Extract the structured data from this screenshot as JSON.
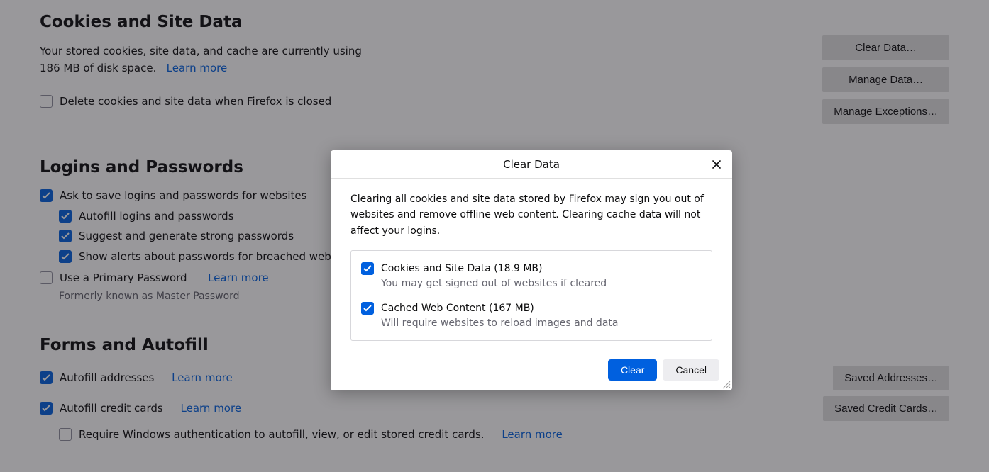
{
  "sections": {
    "cookies": {
      "title": "Cookies and Site Data",
      "desc1": "Your stored cookies, site data, and cache are currently using 186 MB of disk space.",
      "learn_more": "Learn more",
      "delete_on_close": "Delete cookies and site data when Firefox is closed",
      "clear_data_btn": "Clear Data…",
      "manage_data_btn": "Manage Data…",
      "manage_exceptions_btn": "Manage Exceptions…"
    },
    "logins": {
      "title": "Logins and Passwords",
      "ask_save": "Ask to save logins and passwords for websites",
      "autofill": "Autofill logins and passwords",
      "suggest": "Suggest and generate strong passwords",
      "alerts": "Show alerts about passwords for breached websites",
      "primary": "Use a Primary Password",
      "learn_more": "Learn more",
      "formerly": "Formerly known as Master Password"
    },
    "forms": {
      "title": "Forms and Autofill",
      "addresses": "Autofill addresses",
      "learn_more1": "Learn more",
      "saved_addresses_btn": "Saved Addresses…",
      "ccards": "Autofill credit cards",
      "learn_more2": "Learn more",
      "saved_cards_btn": "Saved Credit Cards…",
      "winauth": "Require Windows authentication to autofill, view, or edit stored credit cards.",
      "learn_more3": "Learn more"
    }
  },
  "dialog": {
    "title": "Clear Data",
    "desc": "Clearing all cookies and site data stored by Firefox may sign you out of websites and remove offline web content. Clearing cache data will not affect your logins.",
    "opt1_label": "Cookies and Site Data (18.9 MB)",
    "opt1_sub": "You may get signed out of websites if cleared",
    "opt2_label": "Cached Web Content (167 MB)",
    "opt2_sub": "Will require websites to reload images and data",
    "clear_btn": "Clear",
    "cancel_btn": "Cancel"
  }
}
